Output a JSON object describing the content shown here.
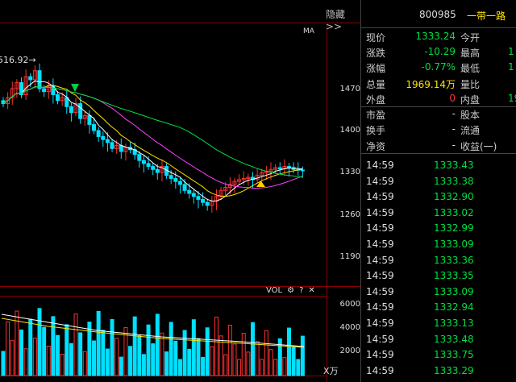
{
  "header": {
    "hide_toggle": "隐藏>>",
    "code": "800985",
    "name": "一带一路"
  },
  "kline": {
    "ma_label": "MA",
    "high_marker": "516.92→",
    "y_ticks": [
      "1470",
      "1400",
      "1330",
      "1260",
      "1190"
    ],
    "colors": {
      "up": "#ff3030",
      "down": "#00e0ff",
      "ma5": "#ffffff",
      "ma10": "#ffe000",
      "ma20": "#ff40ff",
      "ma60": "#00e040"
    }
  },
  "volume": {
    "label": "VOL",
    "settings_icon": "⚙",
    "help_icon": "?",
    "close_icon": "✕",
    "y_ticks": [
      "6000",
      "4000",
      "2000"
    ],
    "unit": "X万"
  },
  "quote": {
    "rows": [
      {
        "label": "现价",
        "value": "1333.24",
        "value_color": "green",
        "label2": "今开",
        "value2": ""
      },
      {
        "label": "涨跌",
        "value": "-10.29",
        "value_color": "green",
        "label2": "最高",
        "value2": "1"
      },
      {
        "label": "涨幅",
        "value": "-0.77%",
        "value_color": "green",
        "label2": "最低",
        "value2": "1"
      },
      {
        "label": "总量",
        "value": "1969.14万",
        "value_color": "yellow",
        "label2": "量比",
        "value2": ""
      },
      {
        "label": "外盘",
        "value": "0",
        "value_color": "red",
        "label2": "内盘",
        "value2": "19"
      },
      {
        "label": "市盈",
        "value": "-",
        "value_color": "white",
        "label2": "股本",
        "value2": ""
      },
      {
        "label": "换手",
        "value": "-",
        "value_color": "white",
        "label2": "流通",
        "value2": ""
      },
      {
        "label": "净资",
        "value": "-",
        "value_color": "white",
        "label2": "收益(一)",
        "value2": ""
      }
    ]
  },
  "ticks": [
    {
      "time": "14:59",
      "price": "1333.43"
    },
    {
      "time": "14:59",
      "price": "1333.38"
    },
    {
      "time": "14:59",
      "price": "1332.90"
    },
    {
      "time": "14:59",
      "price": "1333.02"
    },
    {
      "time": "14:59",
      "price": "1332.99"
    },
    {
      "time": "14:59",
      "price": "1333.09"
    },
    {
      "time": "14:59",
      "price": "1333.36"
    },
    {
      "time": "14:59",
      "price": "1333.35"
    },
    {
      "time": "14:59",
      "price": "1333.09"
    },
    {
      "time": "14:59",
      "price": "1332.94"
    },
    {
      "time": "14:59",
      "price": "1333.13"
    },
    {
      "time": "14:59",
      "price": "1333.48"
    },
    {
      "time": "14:59",
      "price": "1333.75"
    },
    {
      "time": "14:59",
      "price": "1333.29"
    }
  ]
}
